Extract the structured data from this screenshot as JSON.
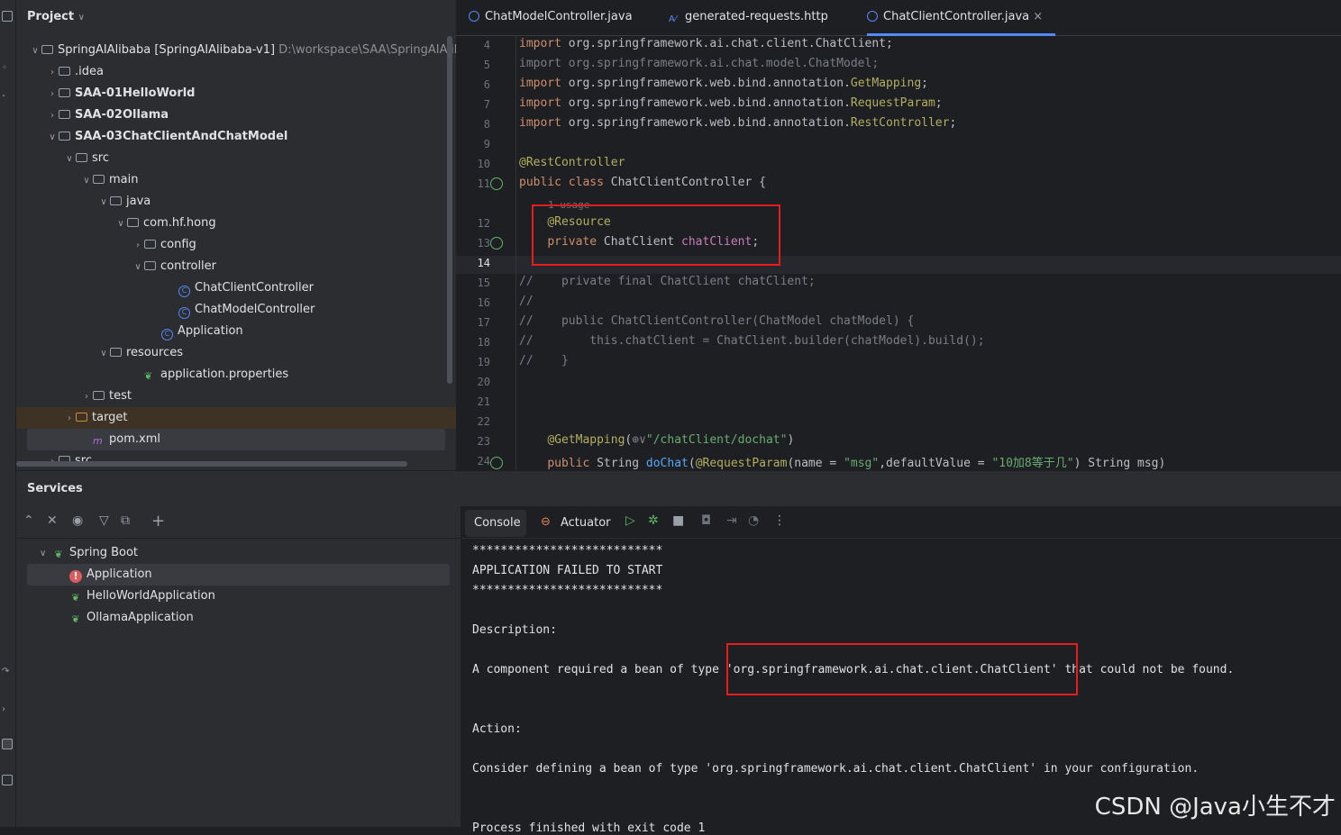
{
  "project": {
    "header": "Project",
    "tree": [
      {
        "label": "SpringAIAlibaba [SpringAIAlibaba-v1]",
        "hint": "D:\\workspace\\SAA\\SpringAIAlibaba",
        "depth": 0,
        "chev": "v",
        "icon": "folder"
      },
      {
        "label": ".idea",
        "depth": 1,
        "chev": ">",
        "icon": "folder"
      },
      {
        "label": "SAA-01HelloWorld",
        "depth": 1,
        "chev": ">",
        "icon": "folder"
      },
      {
        "label": "SAA-02Ollama",
        "depth": 1,
        "chev": ">",
        "icon": "folder"
      },
      {
        "label": "SAA-03ChatClientAndChatModel",
        "depth": 1,
        "chev": "v",
        "icon": "folder"
      },
      {
        "label": "src",
        "depth": 2,
        "chev": "v",
        "icon": "folder"
      },
      {
        "label": "main",
        "depth": 3,
        "chev": "v",
        "icon": "folder"
      },
      {
        "label": "java",
        "depth": 4,
        "chev": "v",
        "icon": "folder"
      },
      {
        "label": "com.hf.hong",
        "depth": 5,
        "chev": "v",
        "icon": "folder"
      },
      {
        "label": "config",
        "depth": 6,
        "chev": ">",
        "icon": "folder"
      },
      {
        "label": "controller",
        "depth": 6,
        "chev": "v",
        "icon": "folder"
      },
      {
        "label": "ChatClientController",
        "depth": 8,
        "chev": "",
        "icon": "class"
      },
      {
        "label": "ChatModelController",
        "depth": 8,
        "chev": "",
        "icon": "class"
      },
      {
        "label": "Application",
        "depth": 7,
        "chev": "",
        "icon": "class"
      },
      {
        "label": "resources",
        "depth": 4,
        "chev": "v",
        "icon": "folder"
      },
      {
        "label": "application.properties",
        "depth": 6,
        "chev": "",
        "icon": "leaf"
      },
      {
        "label": "test",
        "depth": 3,
        "chev": ">",
        "icon": "folder"
      },
      {
        "label": "target",
        "depth": 2,
        "chev": ">",
        "icon": "folder",
        "style": "target"
      },
      {
        "label": "pom.xml",
        "depth": 3,
        "chev": "",
        "icon": "maven",
        "style": "pom"
      },
      {
        "label": "src",
        "depth": 1,
        "chev": ">",
        "icon": "folder"
      }
    ]
  },
  "editor": {
    "tabs": [
      {
        "label": "ChatModelController.java",
        "active": false
      },
      {
        "label": "generated-requests.http",
        "active": false
      },
      {
        "label": "ChatClientController.java",
        "active": true,
        "close": "×"
      }
    ],
    "usage_hint": "1 usage",
    "lines": [
      {
        "n": "4",
        "html": "<span class='kw'>import</span> org.springframework.ai.chat.client.ChatClient;"
      },
      {
        "n": "5",
        "html": "<span class='cm'>import org.springframework.ai.chat.model.ChatModel;</span>"
      },
      {
        "n": "6",
        "html": "<span class='kw'>import</span> org.springframework.web.bind.annotation.<span class='an'>GetMapping</span>;"
      },
      {
        "n": "7",
        "html": "<span class='kw'>import</span> org.springframework.web.bind.annotation.<span class='an'>RequestParam</span>;"
      },
      {
        "n": "8",
        "html": "<span class='kw'>import</span> org.springframework.web.bind.annotation.<span class='an'>RestController</span>;"
      },
      {
        "n": "9",
        "html": ""
      },
      {
        "n": "10",
        "html": "<span class='an'>@RestController</span>"
      },
      {
        "n": "11",
        "html": "<span class='kw'>public class</span> ChatClientController {"
      },
      {
        "n": "12",
        "html": "    <span class='an'>@Resource</span>"
      },
      {
        "n": "13",
        "html": "    <span class='kw'>private</span> ChatClient <span class='fld'>chatClient</span>;"
      },
      {
        "n": "14",
        "html": ""
      },
      {
        "n": "15",
        "html": "<span class='cm'>//    private final ChatClient chatClient;</span>"
      },
      {
        "n": "16",
        "html": "<span class='cm'>//</span>"
      },
      {
        "n": "17",
        "html": "<span class='cm'>//    public ChatClientController(ChatModel chatModel) {</span>"
      },
      {
        "n": "18",
        "html": "<span class='cm'>//        this.chatClient = ChatClient.builder(chatModel).build();</span>"
      },
      {
        "n": "19",
        "html": "<span class='cm'>//    }</span>"
      },
      {
        "n": "20",
        "html": ""
      },
      {
        "n": "21",
        "html": ""
      },
      {
        "n": "22",
        "html": ""
      },
      {
        "n": "23",
        "html": "    <span class='an'>@GetMapping</span>(<span class='cm'>⊕∨</span><span class='st'>\"/chatClient/dochat\"</span>)"
      },
      {
        "n": "24",
        "html": "    <span class='kw'>public</span> String <span class='fn'>doChat</span>(<span class='an'>@RequestParam</span>(name = <span class='st'>\"msg\"</span>,defaultValue = <span class='st'>\"10加8等于几\"</span>) String msg)"
      }
    ]
  },
  "services": {
    "header": "Services",
    "tree": [
      {
        "label": "Spring Boot",
        "depth": 0,
        "chev": "v",
        "icon": "leaf"
      },
      {
        "label": "Application",
        "depth": 1,
        "chev": "",
        "icon": "error",
        "selected": true
      },
      {
        "label": "HelloWorldApplication",
        "depth": 1,
        "chev": "",
        "icon": "leaf"
      },
      {
        "label": "OllamaApplication",
        "depth": 1,
        "chev": "",
        "icon": "leaf"
      }
    ],
    "console_tab": "Console",
    "actuator_tab": "Actuator",
    "console": [
      "***************************",
      "APPLICATION FAILED TO START",
      "***************************",
      "",
      "Description:",
      "",
      "A component required a bean of type 'org.springframework.ai.chat.client.ChatClient' that could not be found.",
      "",
      "",
      "Action:",
      "",
      "Consider defining a bean of type 'org.springframework.ai.chat.client.ChatClient' in your configuration.",
      "",
      "",
      "Process finished with exit code 1"
    ]
  },
  "watermark": "CSDN @Java小生不才"
}
